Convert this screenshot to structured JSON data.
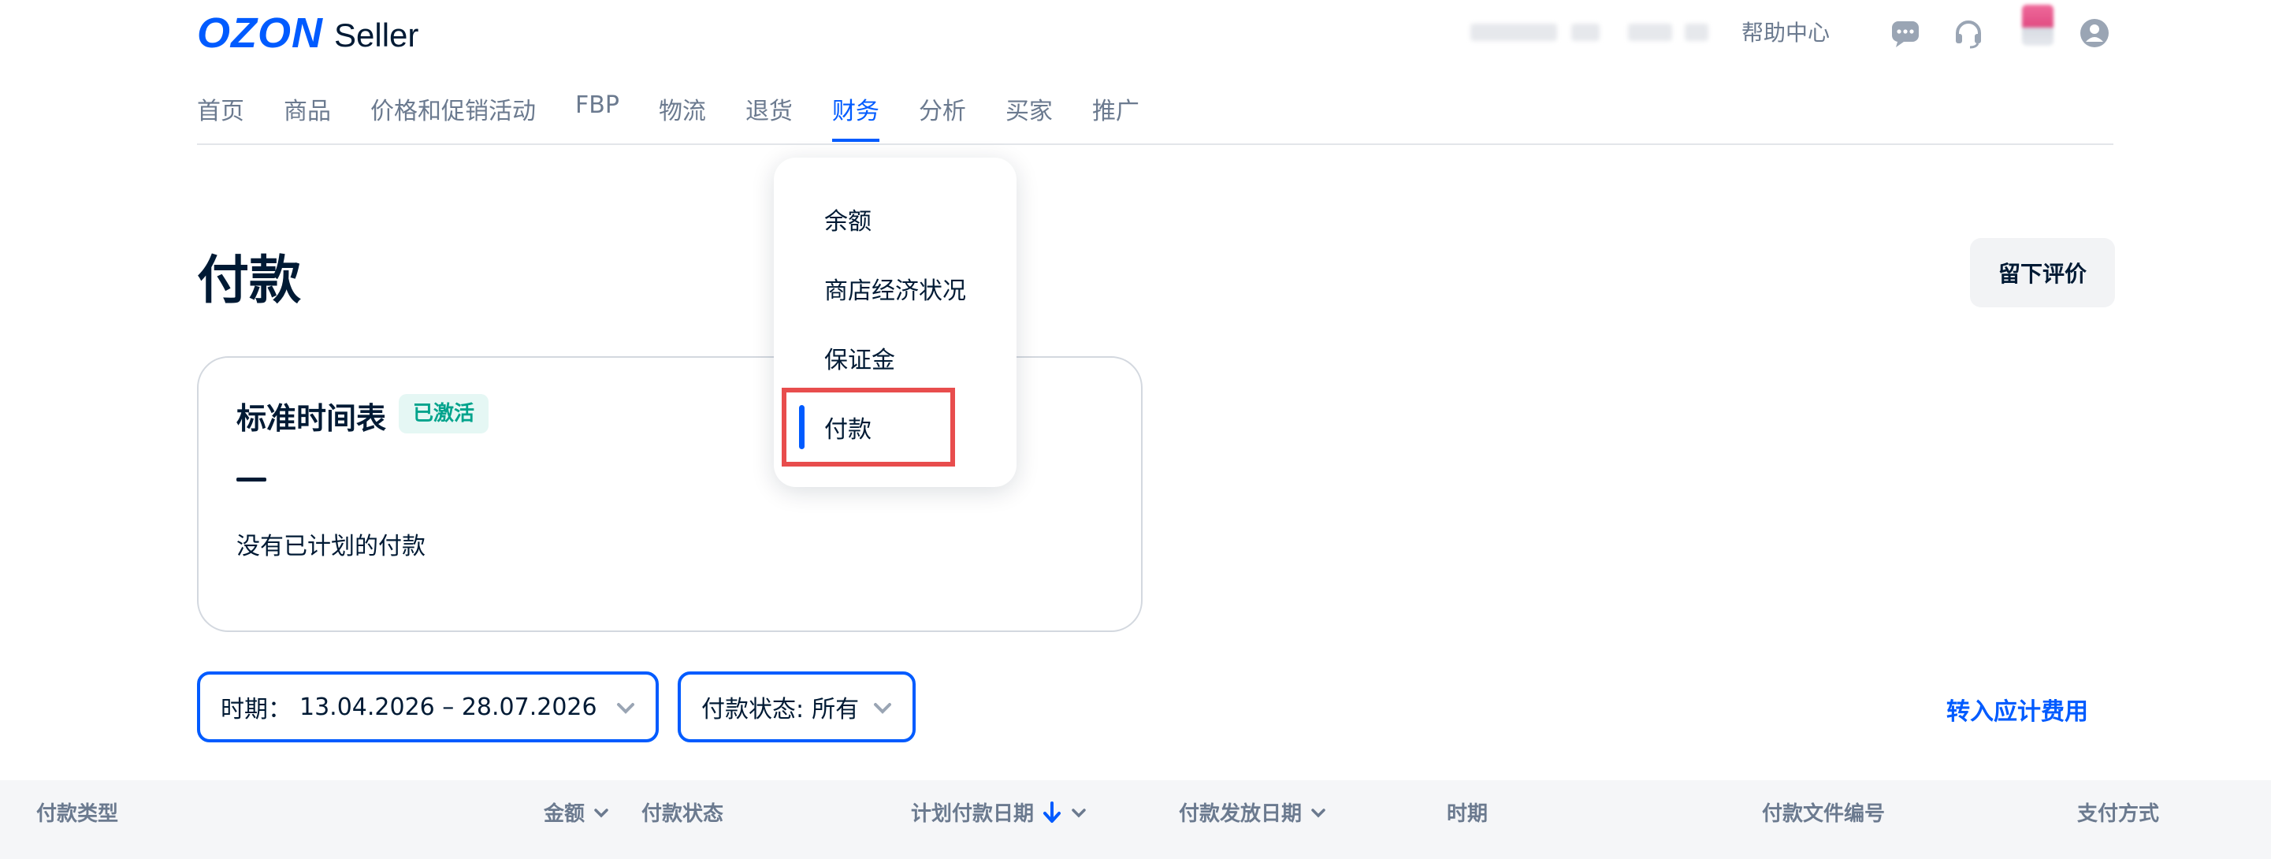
{
  "header": {
    "logo_brand": "OZON",
    "logo_product": "Seller",
    "help_center": "帮助中心",
    "icons": [
      "chat-icon",
      "headset-icon",
      "notification-icon",
      "user-icon"
    ]
  },
  "nav": {
    "items": [
      "首页",
      "商品",
      "价格和促销活动",
      "FBP",
      "物流",
      "退货",
      "财务",
      "分析",
      "买家",
      "推广"
    ],
    "active": "财务"
  },
  "finance_menu": {
    "items": [
      "余额",
      "商店经济状况",
      "保证金",
      "付款"
    ],
    "active": "付款"
  },
  "page": {
    "title": "付款",
    "feedback_button": "留下评价"
  },
  "schedule_card": {
    "title": "标准时间表",
    "status_badge": "已激活",
    "empty_text": "没有已计划的付款"
  },
  "filters": {
    "period_label": "时期：",
    "period_value": "13.04.2026 – 28.07.2026",
    "status_label": "付款状态:",
    "status_value": "所有",
    "goto_link": "转入应计费用"
  },
  "table": {
    "columns": [
      "付款类型",
      "金额",
      "付款状态",
      "计划付款日期",
      "付款发放日期",
      "时期",
      "付款文件编号",
      "支付方式"
    ]
  },
  "colors": {
    "brand_blue": "#005bff",
    "text_dark": "#001a34",
    "text_muted": "#6b7a8f",
    "badge_green": "#00a38c",
    "highlight_red": "#e84d4d"
  }
}
